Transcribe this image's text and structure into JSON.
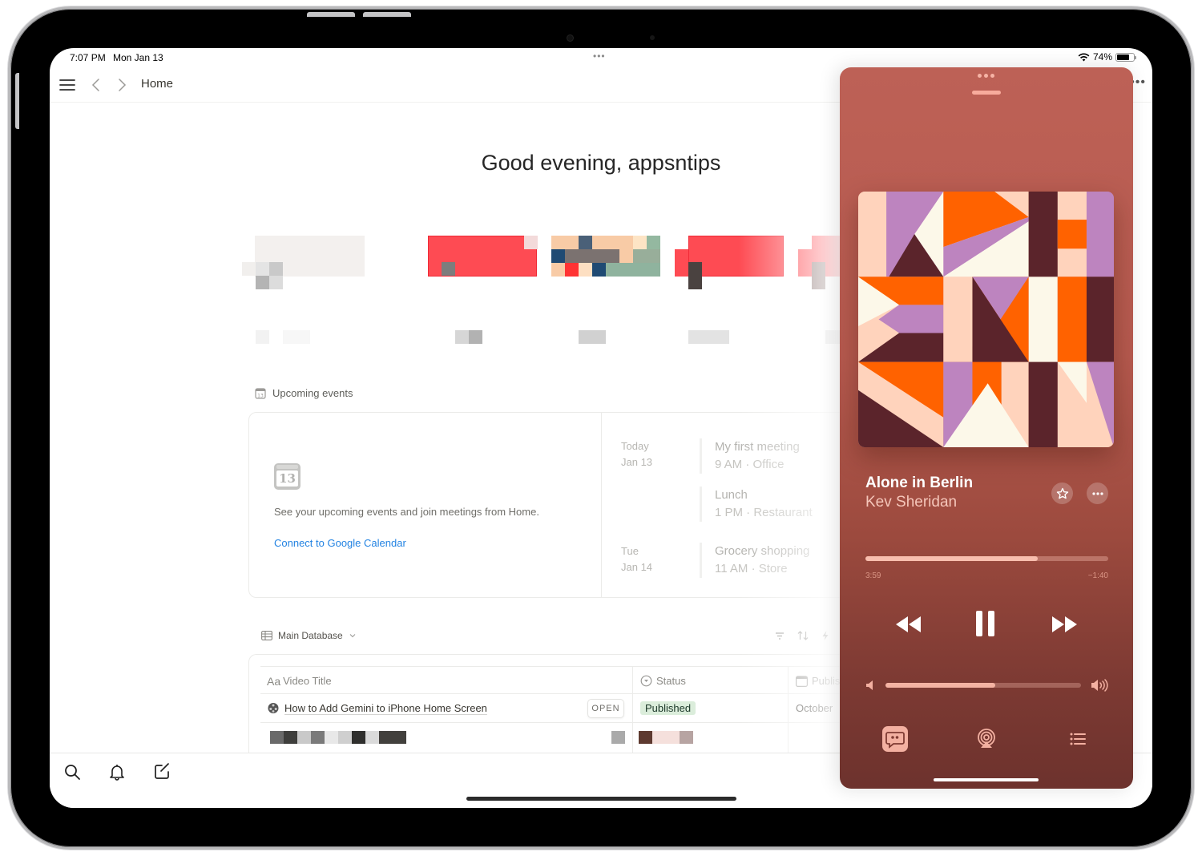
{
  "status_bar": {
    "time": "7:07 PM",
    "date": "Mon Jan 13",
    "battery_percent": "74%",
    "battery_level": 0.74,
    "multitask_dots": "•••"
  },
  "toolbar": {
    "title": "Home",
    "menu_icon": "hamburger-icon",
    "back_icon": "chevron-left-icon",
    "forward_icon": "chevron-right-icon",
    "more_icon": "more-horizontal-icon"
  },
  "home": {
    "greeting": "Good evening, appsntips",
    "recent_cards_count": 5
  },
  "upcoming_events": {
    "heading": "Upcoming events",
    "calendar_day": "13",
    "description": "See your upcoming events and join meetings from Home.",
    "connect_link": "Connect to Google Calendar",
    "days": [
      {
        "day": "Today",
        "date": "Jan 13",
        "events": [
          {
            "title": "My first meeting",
            "subtitle": "9 AM · Office"
          },
          {
            "title": "Lunch",
            "subtitle": "1 PM · Restaurant"
          }
        ]
      },
      {
        "day": "Tue",
        "date": "Jan 14",
        "events": [
          {
            "title": "Grocery shopping",
            "subtitle": "11 AM · Store"
          }
        ]
      }
    ]
  },
  "database": {
    "name": "Main Database",
    "tools": [
      "filter-icon",
      "sort-icon",
      "automation-icon"
    ],
    "columns": [
      {
        "prefix": "Aa",
        "label": "Video Title",
        "icon": "text-icon"
      },
      {
        "label": "Status",
        "icon": "status-select-icon"
      },
      {
        "label": "Publis",
        "icon": "calendar-icon"
      }
    ],
    "rows": [
      {
        "title": "How to Add Gemini to iPhone Home Screen",
        "open_label": "OPEN",
        "status": "Published",
        "status_color": "#dbeddb",
        "published": "October"
      }
    ]
  },
  "tab_bar": {
    "items": [
      "search-icon",
      "bell-icon",
      "compose-icon"
    ]
  },
  "music_player": {
    "song_title": "Alone in Berlin",
    "artist": "Kev Sheridan",
    "elapsed": "3:59",
    "remaining": "−1:40",
    "progress": 0.71,
    "volume": 0.56,
    "is_playing": true,
    "accent_color": "#b95e53",
    "controls": {
      "rewind": "rewind-icon",
      "pause": "pause-icon",
      "forward": "fast-forward-icon",
      "favorite": "star-icon",
      "more": "ellipsis-icon",
      "lyrics": "lyrics-quote-icon",
      "airplay": "airplay-audio-icon",
      "queue": "queue-list-icon",
      "volume_low": "speaker-low-icon",
      "volume_high": "speaker-high-icon"
    },
    "album_art_colors": {
      "peach": "#ffd3bc",
      "lilac": "#bd84bf",
      "cream": "#fcf8e9",
      "orange": "#ff6200",
      "maroon": "#5b242b"
    }
  }
}
